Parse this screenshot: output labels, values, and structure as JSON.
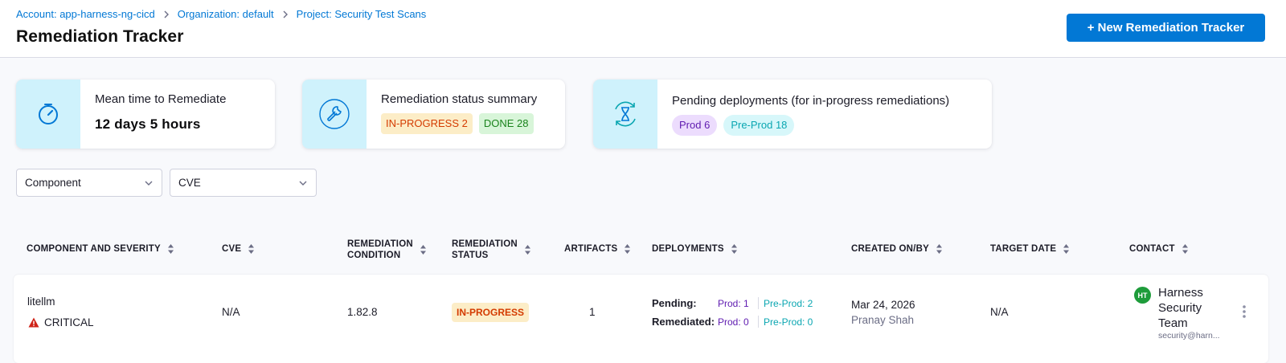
{
  "breadcrumb": {
    "account": "Account: app-harness-ng-cicd",
    "organization": "Organization: default",
    "project": "Project: Security Test Scans"
  },
  "page_title": "Remediation Tracker",
  "new_button_label": "+ New Remediation Tracker",
  "summary": {
    "mttr": {
      "title": "Mean time to Remediate",
      "value": "12 days 5 hours",
      "icon": "timer-icon"
    },
    "status": {
      "title": "Remediation status summary",
      "in_progress": "IN-PROGRESS 2",
      "done": "DONE 28",
      "icon": "wrench-icon"
    },
    "pending": {
      "title": "Pending deployments (for in-progress remediations)",
      "prod": "Prod 6",
      "preprod": "Pre-Prod 18",
      "icon": "hourglass-cycle-icon"
    }
  },
  "filters": {
    "component": "Component",
    "cve": "CVE"
  },
  "columns": {
    "component": "COMPONENT AND SEVERITY",
    "cve": "CVE",
    "condition_1": "REMEDIATION",
    "condition_2": "CONDITION",
    "status_1": "REMEDIATION",
    "status_2": "STATUS",
    "artifacts": "ARTIFACTS",
    "deployments": "DEPLOYMENTS",
    "created": "CREATED ON/BY",
    "target": "TARGET DATE",
    "contact": "CONTACT"
  },
  "rows": [
    {
      "component": "litellm",
      "severity": "CRITICAL",
      "cve": "N/A",
      "condition": "1.82.8",
      "status": "IN-PROGRESS",
      "artifacts": "1",
      "pending_label": "Pending:",
      "remediated_label": "Remediated:",
      "pending_prod": "Prod: 1",
      "pending_preprod": "Pre-Prod: 2",
      "remediated_prod": "Prod: 0",
      "remediated_preprod": "Pre-Prod: 0",
      "created_on": "Mar 24, 2026",
      "created_by": "Pranay Shah",
      "target_date": "N/A",
      "contact_initials": "HT",
      "contact_name_1": "Harness",
      "contact_name_2": "Security",
      "contact_name_3": "Team",
      "contact_email": "security@harn..."
    }
  ],
  "colors": {
    "primary": "#0278d5",
    "icon_bg": "#cff2fc",
    "icon_stroke": "#0278d5",
    "in_progress_bg": "#fcedc7",
    "in_progress_text": "#d43b00",
    "done_bg": "#d8f5d9",
    "done_text": "#1b841d",
    "prod_text": "#5f1bb0",
    "preprod_text": "#0aa6b1",
    "critical": "#cf2318"
  }
}
